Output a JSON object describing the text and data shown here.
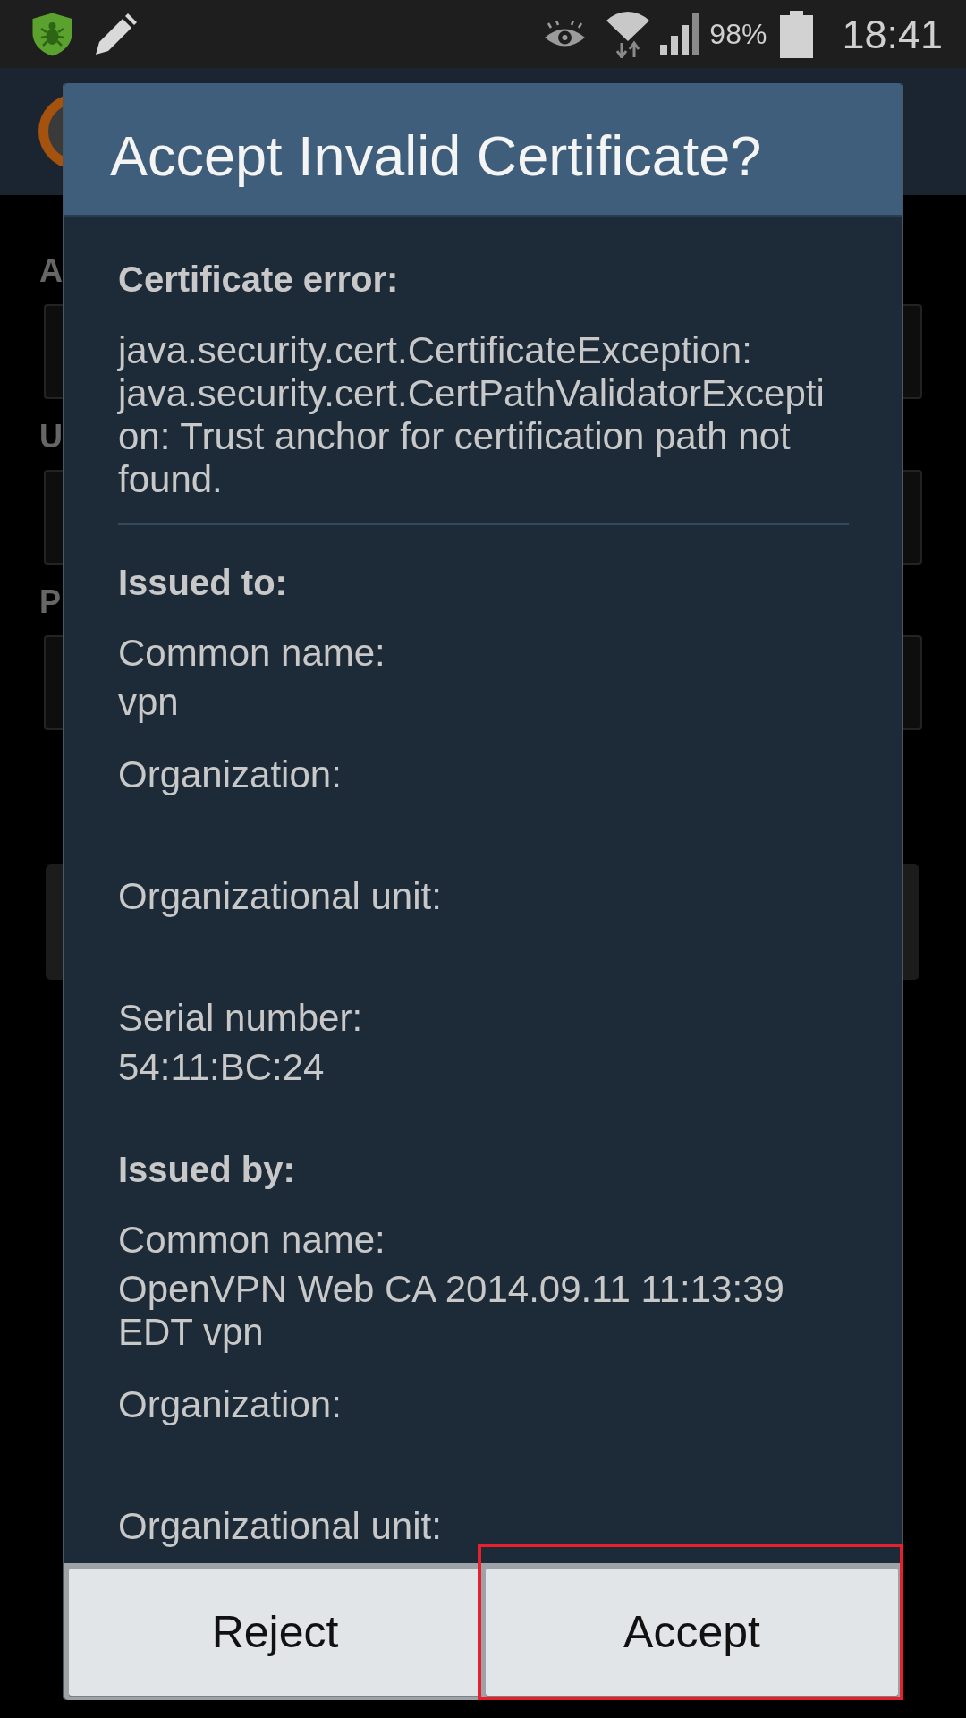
{
  "status_bar": {
    "battery_percent": "98%",
    "time": "18:41"
  },
  "background_app": {
    "fields": [
      {
        "label": "A"
      },
      {
        "label": "U"
      },
      {
        "label": "P"
      }
    ]
  },
  "dialog": {
    "title": "Accept Invalid Certificate?",
    "error": {
      "heading": "Certificate error:",
      "message": "java.security.cert.CertificateException: java.security.cert.CertPathValidatorException: Trust anchor for certification path not found."
    },
    "sections": [
      {
        "heading": "Issued to:",
        "fields": [
          {
            "label": "Common name:",
            "value": "vpn"
          },
          {
            "label": "Organization:"
          },
          {
            "label": "Organizational unit:"
          },
          {
            "label": "Serial number:",
            "value": "54:11:BC:24"
          }
        ]
      },
      {
        "heading": "Issued by:",
        "fields": [
          {
            "label": "Common name:",
            "value": "OpenVPN Web CA 2014.09.11 11:13:39 EDT vpn"
          },
          {
            "label": "Organization:"
          },
          {
            "label": "Organizational unit:"
          }
        ]
      }
    ],
    "buttons": [
      {
        "label": "Reject",
        "highlighted": false
      },
      {
        "label": "Accept",
        "highlighted": true
      }
    ]
  }
}
